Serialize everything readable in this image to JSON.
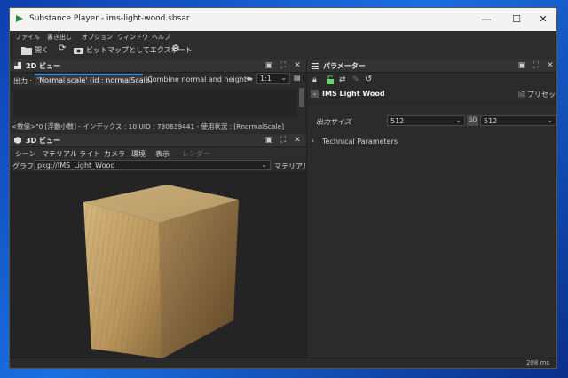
{
  "window": {
    "title": "Substance Player - ims-light-wood.sbsar",
    "minimize": "—",
    "maximize": "☐",
    "close": "✕"
  },
  "menu": [
    "ファイル",
    "書き出し",
    "オプション",
    "ウィンドウ",
    "ヘルプ"
  ],
  "toolbar": {
    "open": "開く",
    "export": "ビットマップとしてエクスポート"
  },
  "view2d": {
    "title": "2D ビュー",
    "output_label": "出力 :",
    "tabs": [
      "'Normal scale' (id : normalScale)",
      "'Combine normal and height' (id : ex"
    ],
    "zoom": "1:1",
    "status": "<数値>\"0 [浮動小数] - インデックス : 10 UID : 730639441 - 使用状況 : [RnormalScale]"
  },
  "view3d": {
    "title": "3D ビュー",
    "menu": [
      "シーン",
      "マテリアル",
      "ライト",
      "カメラ",
      "環境",
      "表示",
      "レンダー"
    ],
    "graph_label": "グラフ :",
    "graph_value": "pkg://IMS_Light_Wood",
    "material_label": "マテリアル"
  },
  "params": {
    "title": "パラメーター",
    "section": "IMS Light Wood",
    "preset": "プリセット",
    "output_size_label": "出力サイズ",
    "size_w": "512",
    "size_h": "512",
    "link": "GO",
    "technical": "Technical Parameters"
  },
  "statusbar": {
    "time": "208 ms"
  },
  "colors": {
    "accent": "#2f8de4",
    "panel": "#2b2b2b",
    "viewport": "#242424",
    "wood": "#c9a56a"
  }
}
